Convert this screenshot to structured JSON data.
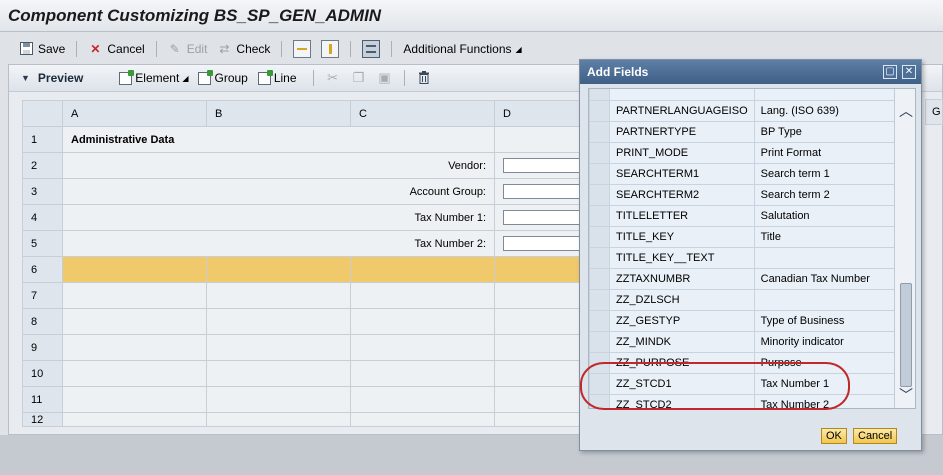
{
  "window": {
    "title": "Component Customizing BS_SP_GEN_ADMIN"
  },
  "toolbar": {
    "save_label": "Save",
    "cancel_label": "Cancel",
    "edit_label": "Edit",
    "check_label": "Check",
    "additional_label": "Additional Functions"
  },
  "preview": {
    "title": "Preview",
    "element_label": "Element",
    "group_label": "Group",
    "line_label": "Line"
  },
  "grid": {
    "columns": [
      "A",
      "B",
      "C",
      "D"
    ],
    "extra_column": "G",
    "rows": [
      {
        "num": "1",
        "label": "Administrative Data"
      },
      {
        "num": "2",
        "label": "Vendor:"
      },
      {
        "num": "3",
        "label": "Account Group:"
      },
      {
        "num": "4",
        "label": "Tax Number 1:"
      },
      {
        "num": "5",
        "label": "Tax Number 2:"
      },
      {
        "num": "6",
        "label": ""
      },
      {
        "num": "7",
        "label": ""
      },
      {
        "num": "8",
        "label": ""
      },
      {
        "num": "9",
        "label": ""
      },
      {
        "num": "10",
        "label": ""
      },
      {
        "num": "11",
        "label": ""
      },
      {
        "num": "12",
        "label": ""
      }
    ]
  },
  "dialog": {
    "title": "Add Fields",
    "fields": [
      {
        "name": "",
        "desc": ""
      },
      {
        "name": "PARTNERLANGUAGEISO",
        "desc": "Lang. (ISO 639)"
      },
      {
        "name": "PARTNERTYPE",
        "desc": "BP Type"
      },
      {
        "name": "PRINT_MODE",
        "desc": "Print Format"
      },
      {
        "name": "SEARCHTERM1",
        "desc": "Search term 1"
      },
      {
        "name": "SEARCHTERM2",
        "desc": "Search term 2"
      },
      {
        "name": "TITLELETTER",
        "desc": "Salutation"
      },
      {
        "name": "TITLE_KEY",
        "desc": "Title"
      },
      {
        "name": "TITLE_KEY__TEXT",
        "desc": ""
      },
      {
        "name": "ZZTAXNUMBR",
        "desc": "Canadian Tax Number"
      },
      {
        "name": "ZZ_DZLSCH",
        "desc": ""
      },
      {
        "name": "ZZ_GESTYP",
        "desc": "Type of Business"
      },
      {
        "name": "ZZ_MINDK",
        "desc": "Minority indicator"
      },
      {
        "name": "ZZ_PURPOSE",
        "desc": "Purpose"
      },
      {
        "name": "ZZ_STCD1",
        "desc": "Tax Number 1"
      },
      {
        "name": "ZZ_STCD2",
        "desc": "Tax Number 2"
      },
      {
        "name": "",
        "desc": ""
      }
    ],
    "ok_label": "OK",
    "cancel_label": "Cancel"
  },
  "colors": {
    "selected_row": "#f0c96a",
    "dialog_title": "#4b6b93",
    "highlight_ring": "#c0282a"
  }
}
